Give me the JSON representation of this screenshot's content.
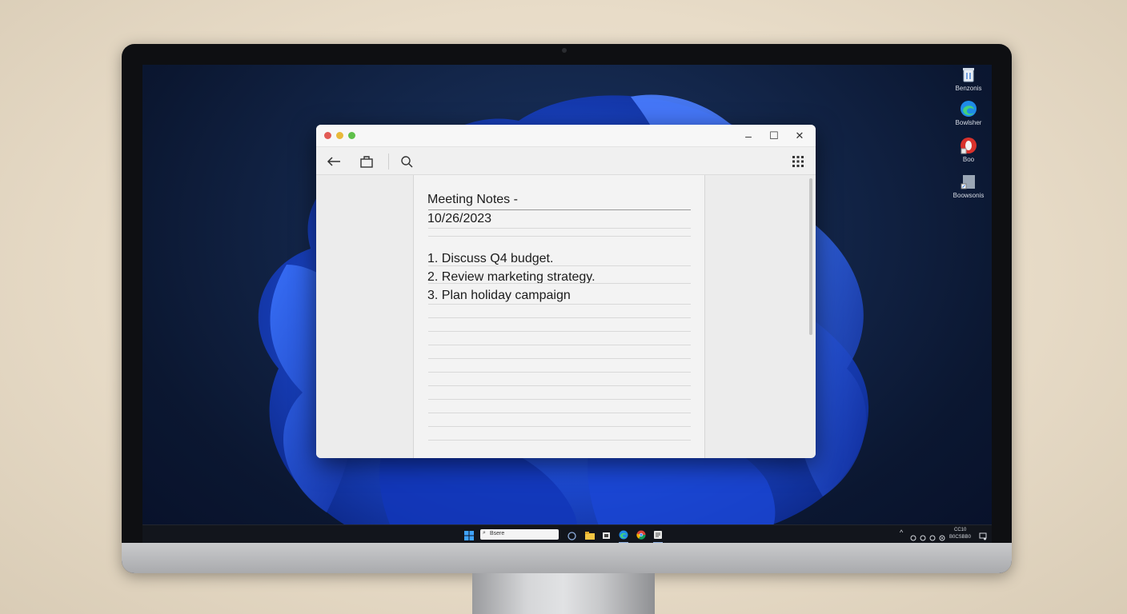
{
  "desktop": {
    "icons": [
      {
        "label": "Benzonis",
        "icon": "recycle-bin-icon"
      },
      {
        "label": "Bowlsher",
        "icon": "edge-icon"
      },
      {
        "label": "Boo",
        "icon": "opera-icon"
      },
      {
        "label": "Boowsonis",
        "icon": "file-shortcut-icon"
      }
    ]
  },
  "window": {
    "controls": {
      "minimize": "–",
      "maximize": "☐",
      "close": "✕"
    },
    "toolbar": {
      "back_icon": "back-arrow-icon",
      "bag_icon": "shopping-bag-icon",
      "search_icon": "search-icon",
      "grid_icon": "grid-icon"
    },
    "note": {
      "title": "Meeting Notes -",
      "date": "10/26/2023",
      "items": [
        "1. Discuss Q4 budget.",
        "2. Review marketing strategy.",
        "3. Plan holiday campaign"
      ]
    }
  },
  "taskbar": {
    "search_placeholder": "Bsere",
    "clock_time": "CC10",
    "clock_date": "B0CSBB0"
  },
  "colors": {
    "accent_blue": "#2f6bff",
    "dot_red": "#e25b55",
    "dot_yellow": "#e8b93b",
    "dot_green": "#5fc04a"
  }
}
